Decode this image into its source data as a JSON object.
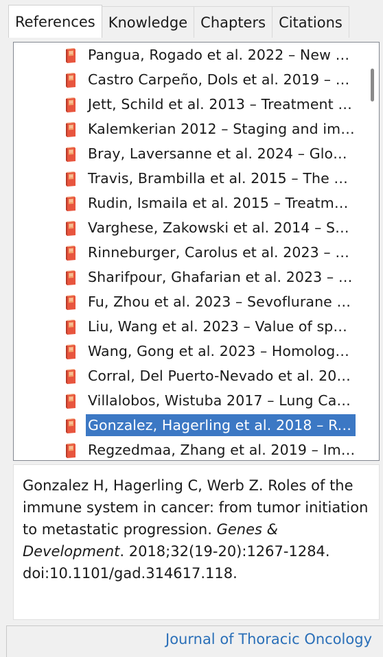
{
  "tabs": [
    {
      "label": "References",
      "active": true
    },
    {
      "label": "Knowledge",
      "active": false
    },
    {
      "label": "Chapters",
      "active": false
    },
    {
      "label": "Citations",
      "active": false
    }
  ],
  "references": [
    {
      "text": "Pangua, Rogado et al. 2022 – New p…",
      "icon": "book-icon"
    },
    {
      "text": "Castro Carpeño, Dols et al. 2019 – S…",
      "icon": "book-icon"
    },
    {
      "text": "Jett, Schild et al. 2013 – Treatment o…",
      "icon": "book-icon"
    },
    {
      "text": "Kalemkerian 2012 – Staging and ima…",
      "icon": "book-icon"
    },
    {
      "text": "Bray, Laversanne et al. 2024 – Global…",
      "icon": "book-icon"
    },
    {
      "text": "Travis, Brambilla et al. 2015 – The 20…",
      "icon": "book-icon"
    },
    {
      "text": "Rudin, Ismaila et al. 2015 – Treatmen…",
      "icon": "book-icon"
    },
    {
      "text": "Varghese, Zakowski et al. 2014 – Sm…",
      "icon": "book-icon"
    },
    {
      "text": "Rinneburger, Carolus et al. 2023 – A…",
      "icon": "book-icon"
    },
    {
      "text": "Sharifpour, Ghafarian et al. 2023 – R…",
      "icon": "book-icon"
    },
    {
      "text": "Fu, Zhou et al. 2023 – Sevoflurane A…",
      "icon": "book-icon"
    },
    {
      "text": "Liu, Wang et al. 2023 – Value of spec…",
      "icon": "book-icon"
    },
    {
      "text": "Wang, Gong et al. 2023 – Homologo…",
      "icon": "book-icon"
    },
    {
      "text": "Corral, Del Puerto-Nevado et al. 202…",
      "icon": "book-icon"
    },
    {
      "text": "Villalobos, Wistuba 2017 – Lung Can…",
      "icon": "book-icon"
    },
    {
      "text": "Gonzalez, Hagerling et al. 2018 – Rol…",
      "icon": "book-icon",
      "selected": true
    },
    {
      "text": "Regzedmaa, Zhang et al. 2019 – Im…",
      "icon": "book-icon"
    }
  ],
  "citation": {
    "authors": "Gonzalez H, Hagerling C, Werb Z. Roles of the immune system in cancer: from tumor initiation to metastatic progression. ",
    "journal": "Genes & Development",
    "details": ". 2018;32(19-20):1267-1284. doi:10.1101/gad.314617.118."
  },
  "footer": {
    "journal_link": "Journal of Thoracic Oncology"
  },
  "colors": {
    "selection": "#3c78c4",
    "link": "#2a6fb8",
    "book_red": "#e8553e",
    "book_orange": "#f3a36b"
  }
}
